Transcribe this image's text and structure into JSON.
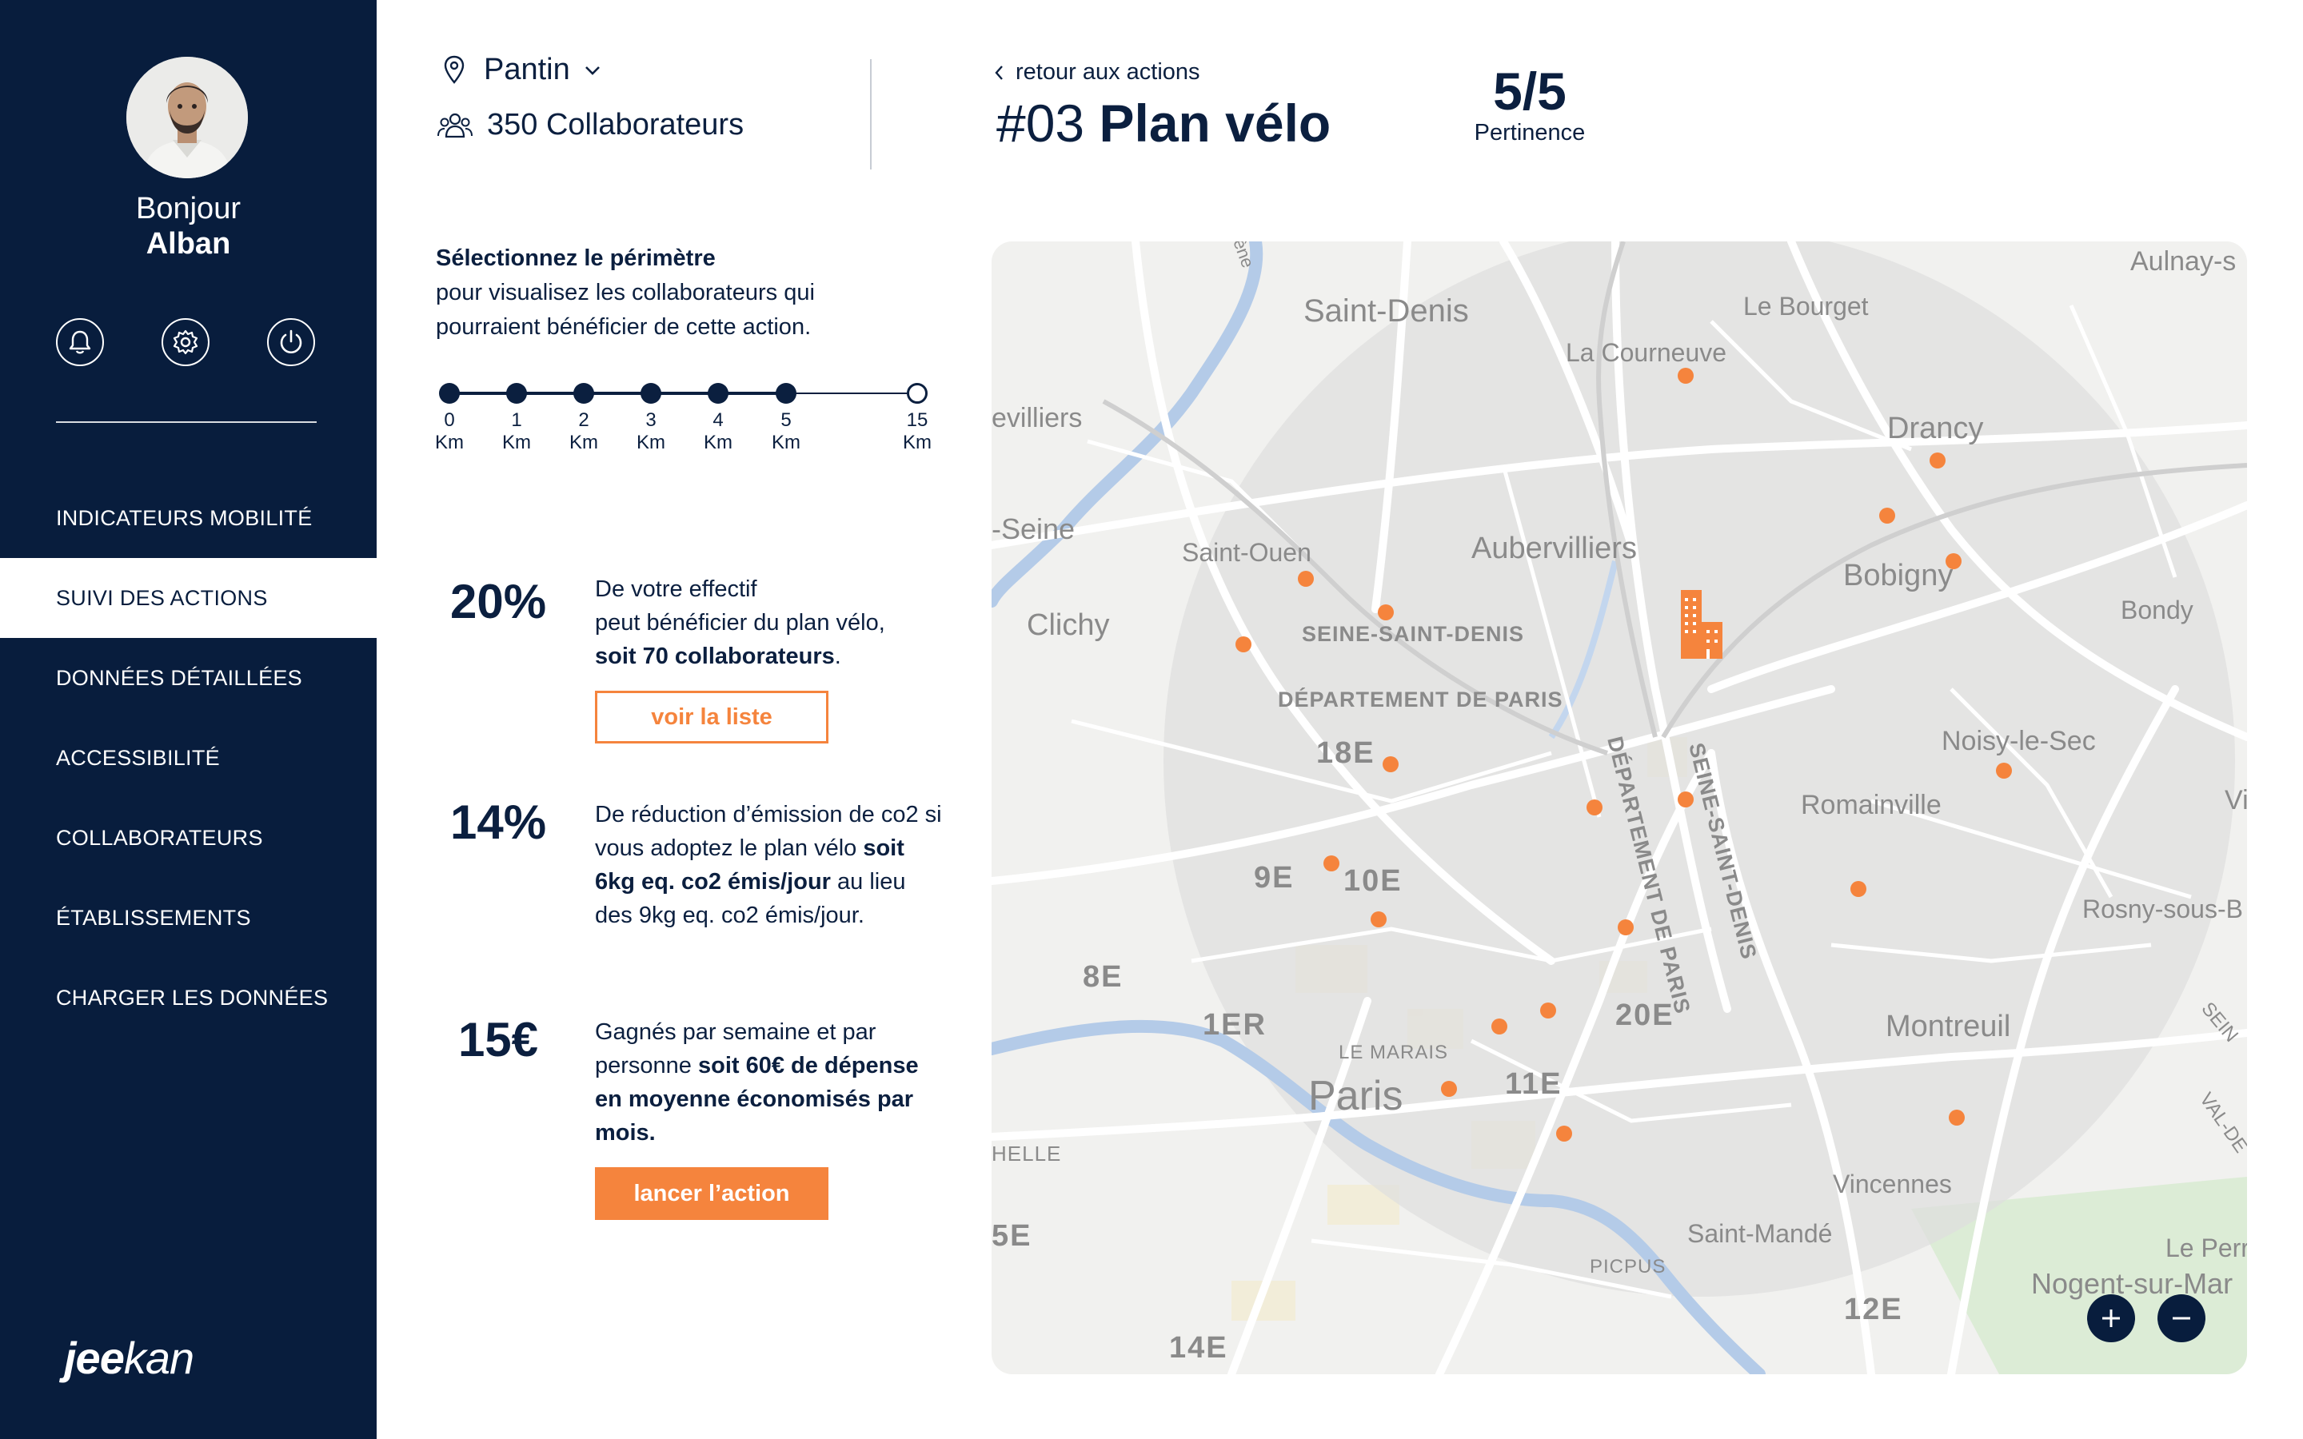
{
  "user": {
    "greeting": "Bonjour",
    "name": "Alban"
  },
  "sidebar": {
    "items": [
      {
        "label": "INDICATEURS MOBILITÉ",
        "active": false
      },
      {
        "label": "SUIVI DES ACTIONS",
        "active": true
      },
      {
        "label": "DONNÉES DÉTAILLÉES",
        "active": false
      },
      {
        "label": "ACCESSIBILITÉ",
        "active": false
      },
      {
        "label": "COLLABORATEURS",
        "active": false
      },
      {
        "label": "ÉTABLISSEMENTS",
        "active": false
      },
      {
        "label": "CHARGER LES DONNÉES",
        "active": false
      }
    ],
    "brand": {
      "part1": "jee",
      "part2": "kan"
    }
  },
  "header": {
    "location": "Pantin",
    "staff": "350 Collaborateurs",
    "back_label": "retour aux actions",
    "action_number": "#03",
    "action_name": "Plan vélo",
    "score_value": "5/5",
    "score_label": "Pertinence"
  },
  "perimeter": {
    "title": "Sélectionnez le périmètre",
    "text": "pour visualisez les collaborateurs qui pourraient bénéficier de cette action.",
    "unit": "Km",
    "stops": [
      "0",
      "1",
      "2",
      "3",
      "4",
      "5",
      "15"
    ],
    "selected": "5"
  },
  "stats": [
    {
      "value": "20%",
      "line1": "De votre effectif",
      "line2": "peut bénéficier du plan vélo,",
      "bold": "soit 70 collaborateurs",
      "end": "."
    },
    {
      "value": "14%",
      "pre": "De réduction d’émission de co2 si vous adoptez le plan vélo ",
      "bold": "soit 6kg eq. co2 émis/jour",
      "post": "  au lieu des 9kg eq. co2 émis/jour."
    },
    {
      "value": "15€",
      "pre": "Gagnés par semaine et par personne ",
      "bold": "soit 60€ de dépense en moyenne économisés par mois."
    }
  ],
  "buttons": {
    "list": "voir la liste",
    "launch": "lancer l’action"
  },
  "map": {
    "labels": {
      "saint_denis": "Saint-Denis",
      "le_bourget": "Le Bourget",
      "la_courneuve": "La Courneuve",
      "aulnay": "Aulnay-s",
      "villiers": "evilliers",
      "seine": "-Seine",
      "drancy": "Drancy",
      "saint_ouen": "Saint-Ouen",
      "aubervilliers": "Aubervilliers",
      "bobigny": "Bobigny",
      "bondy": "Bondy",
      "clichy": "Clichy",
      "ssd": "SEINE-SAINT-DENIS",
      "dep_paris": "DÉPARTEMENT DE PARIS",
      "arr18": "18E",
      "noisy": "Noisy-le-Sec",
      "romainville": "Romainville",
      "vi": "Vi",
      "arr9": "9E",
      "arr10": "10E",
      "rosny": "Rosny-sous-B",
      "arr8": "8E",
      "arr1": "1ER",
      "arr20": "20E",
      "montreuil": "Montreuil",
      "le_marais": "LE MARAIS",
      "paris": "Paris",
      "arr11": "11E",
      "elle": "HELLE",
      "vincennes": "Vincennes",
      "saint_mande": "Saint-Mandé",
      "arr5": "5E",
      "picpus": "PICPUS",
      "le_perr": "Le Perr",
      "nogent": "Nogent-sur-Mar",
      "arr12": "12E",
      "arr14": "14E",
      "dep_paris_v": "DÉPARTEMENT DE PARIS",
      "ssd_v": "SEINE-SAINT-DENIS",
      "seine_r": "SEIN",
      "val_de": "VAL-DE",
      "ene": "ène"
    },
    "colors": {
      "point": "#f5843d",
      "office": "#f5843d",
      "radius": "#dedede"
    }
  },
  "colors": {
    "navy": "#081d3d",
    "accent": "#f5843d"
  }
}
